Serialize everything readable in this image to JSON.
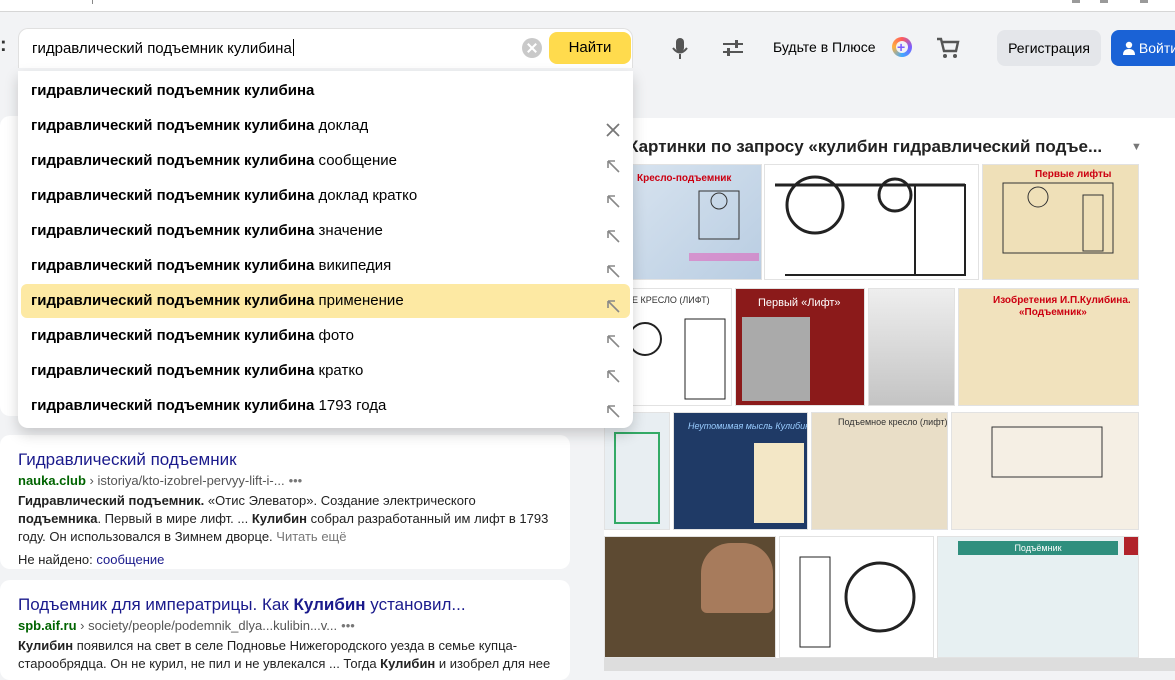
{
  "search": {
    "value": "гидравлический подъемник кулибина",
    "find_label": "Найти"
  },
  "header": {
    "plus_label": "Будьте в Плюсе",
    "register_label": "Регистрация",
    "login_label": "Войти"
  },
  "suggestions": [
    {
      "bold": "гидравлический подъемник кулибина",
      "rest": "",
      "icon": "none"
    },
    {
      "bold": "гидравлический подъемник кулибина",
      "rest": " доклад",
      "icon": "close-icon"
    },
    {
      "bold": "гидравлический подъемник кулибина",
      "rest": " сообщение",
      "icon": "arrow-up-left-icon"
    },
    {
      "bold": "гидравлический подъемник кулибина",
      "rest": " доклад кратко",
      "icon": "arrow-up-left-icon"
    },
    {
      "bold": "гидравлический подъемник кулибина",
      "rest": " значение",
      "icon": "arrow-up-left-icon"
    },
    {
      "bold": "гидравлический подъемник кулибина",
      "rest": " википедия",
      "icon": "arrow-up-left-icon"
    },
    {
      "bold": "гидравлический подъемник кулибина",
      "rest": " применение",
      "icon": "arrow-up-left-icon",
      "highlighted": true
    },
    {
      "bold": "гидравлический подъемник кулибина",
      "rest": " фото",
      "icon": "arrow-up-left-icon"
    },
    {
      "bold": "гидравлический подъемник кулибина",
      "rest": " кратко",
      "icon": "arrow-up-left-icon"
    },
    {
      "bold": "гидравлический подъемник кулибина",
      "rest": " 1793 года",
      "icon": "arrow-up-left-icon"
    }
  ],
  "results": [
    {
      "title": "Гидравлический подъемник",
      "domain": "nauka.club",
      "path": "› istoriya/kto-izobrel-pervyy-lift-i-...",
      "snippet_html": "<b>Гидравлический подъемник.</b> «Отис Элеватор». Создание электрического <b>подъемника</b>. Первый в мире лифт. ... <b>Кулибин</b> собрал разработанный им лифт в 1793 году. Он использовался в Зимнем дворце.",
      "read_more": "Читать ещё",
      "not_found_label": "Не найдено:",
      "not_found_word": "сообщение"
    },
    {
      "title_html": "Подъемник для императрицы. Как <b>Кулибин</b> установил...",
      "domain": "spb.aif.ru",
      "path": "› society/people/podemnik_dlya...kulibin...v...",
      "snippet_html": "<b>Кулибин</b> появился на свет в селе Подновье Нижегородского уезда в семье купца-старообрядца. Он не курил, не пил и не увлекался ... Тогда <b>Кулибин</b> и изобрел для нее"
    }
  ],
  "images_panel": {
    "title": "Картинки по запросу «кулибин гидравлический подъе...",
    "captions": {
      "kreslo": "Кресло-подъемник",
      "pervye_lifty": "Первые лифты",
      "podemnoe_kreslo_lift": "ЕМНОЕ КРЕСЛО (ЛИФТ)",
      "pervyy_lift": "Первый «Лифт»",
      "izobreteniya": "Изобретения И.П.Кулибина.",
      "izobreteniya2": "«Подъемник»",
      "neutomimaya": "Неутомимая мысль Кулибина",
      "podemnoe_kreslo2": "Подъемное кресло (лифт)",
      "podemnik": "Подъёмник"
    }
  }
}
